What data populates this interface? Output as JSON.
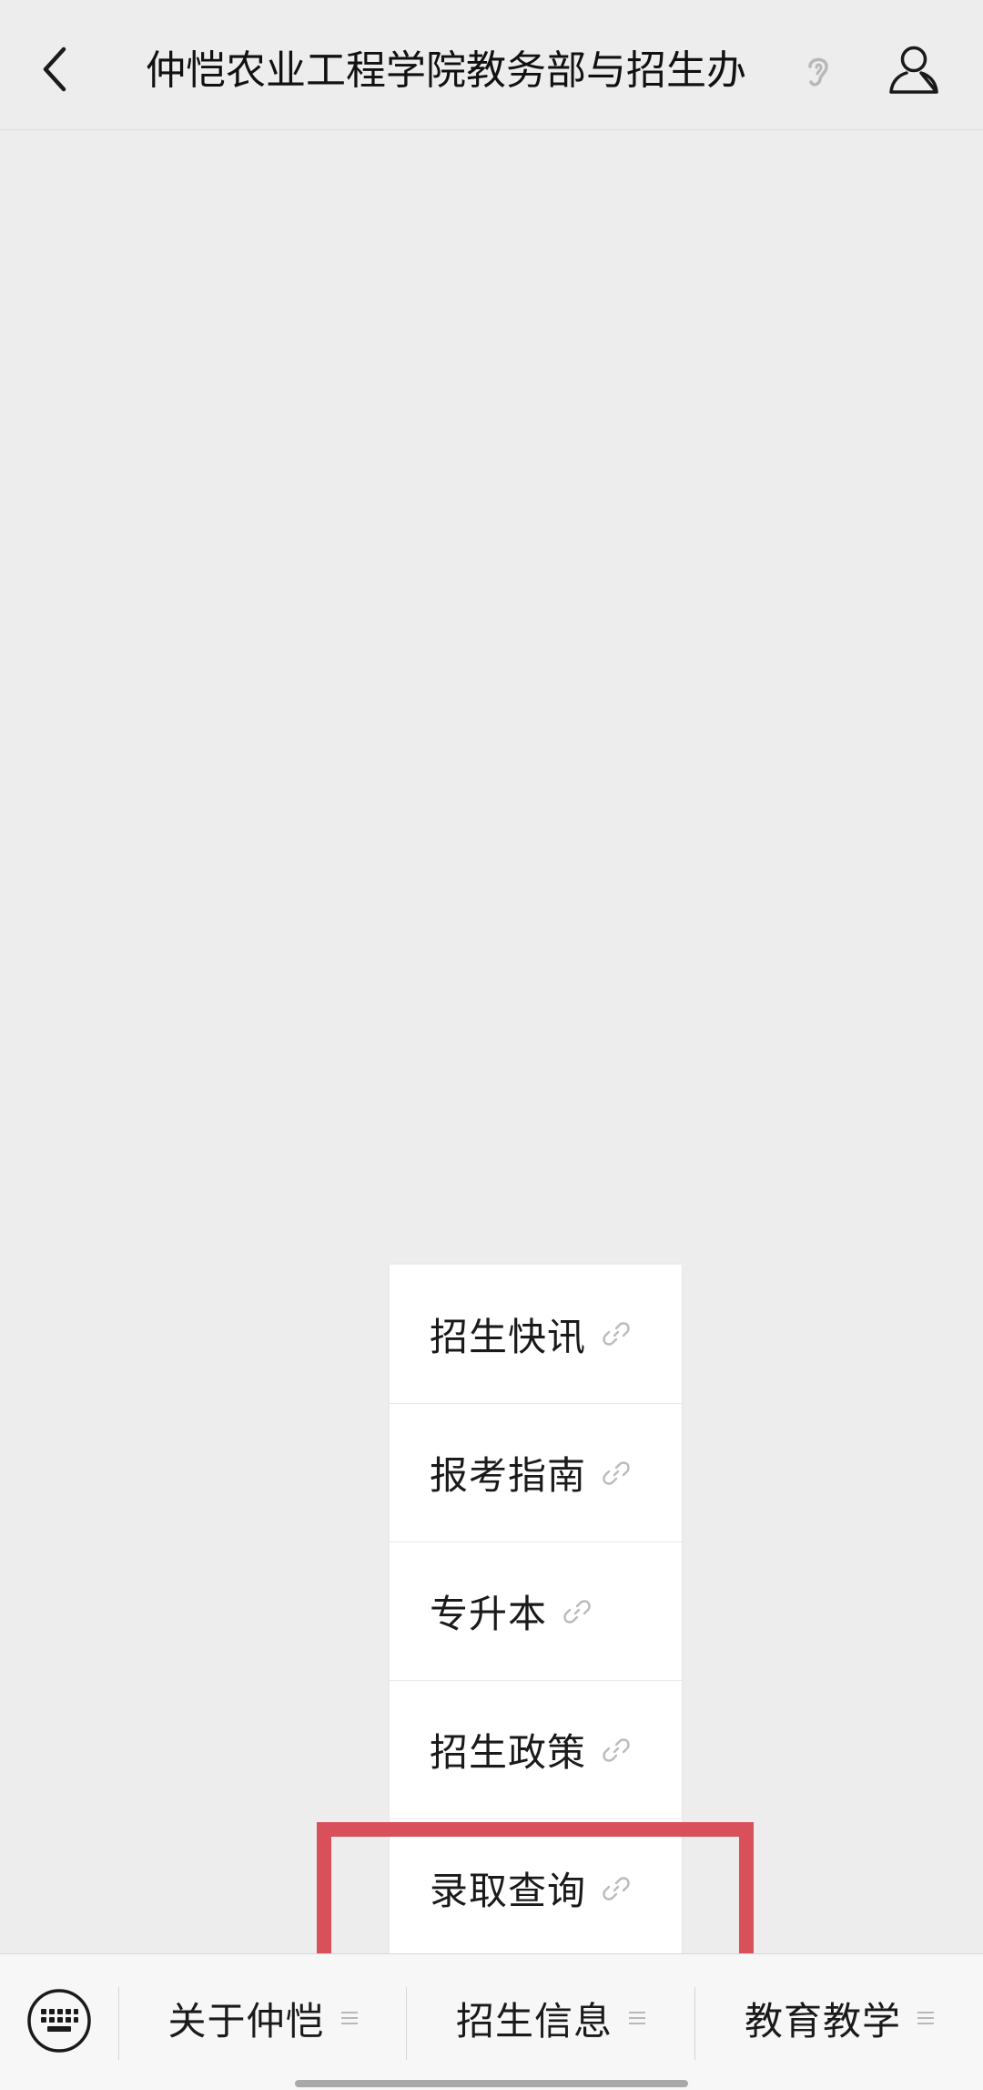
{
  "header": {
    "title": "仲恺农业工程学院教务部与招生办",
    "back_icon": "chevron-left-icon",
    "listen_icon": "ear-icon",
    "profile_icon": "user-icon"
  },
  "popup_menu": {
    "items": [
      {
        "label": "招生快讯",
        "icon": "link-icon"
      },
      {
        "label": "报考指南",
        "icon": "link-icon"
      },
      {
        "label": "专升本",
        "icon": "link-icon"
      },
      {
        "label": "招生政策",
        "icon": "link-icon"
      },
      {
        "label": "录取查询",
        "icon": "link-icon",
        "highlighted": true
      }
    ]
  },
  "bottom_menu": {
    "keyboard_icon": "keyboard-icon",
    "tabs": [
      {
        "label": "关于仲恺",
        "icon": "menu-lines-icon"
      },
      {
        "label": "招生信息",
        "icon": "menu-lines-icon",
        "active": true
      },
      {
        "label": "教育教学",
        "icon": "menu-lines-icon"
      }
    ]
  },
  "colors": {
    "background": "#ededed",
    "popup_background": "#ffffff",
    "highlight_border": "#d9505a",
    "text": "#1a1a1a",
    "icon_muted": "#b8b8b8"
  }
}
